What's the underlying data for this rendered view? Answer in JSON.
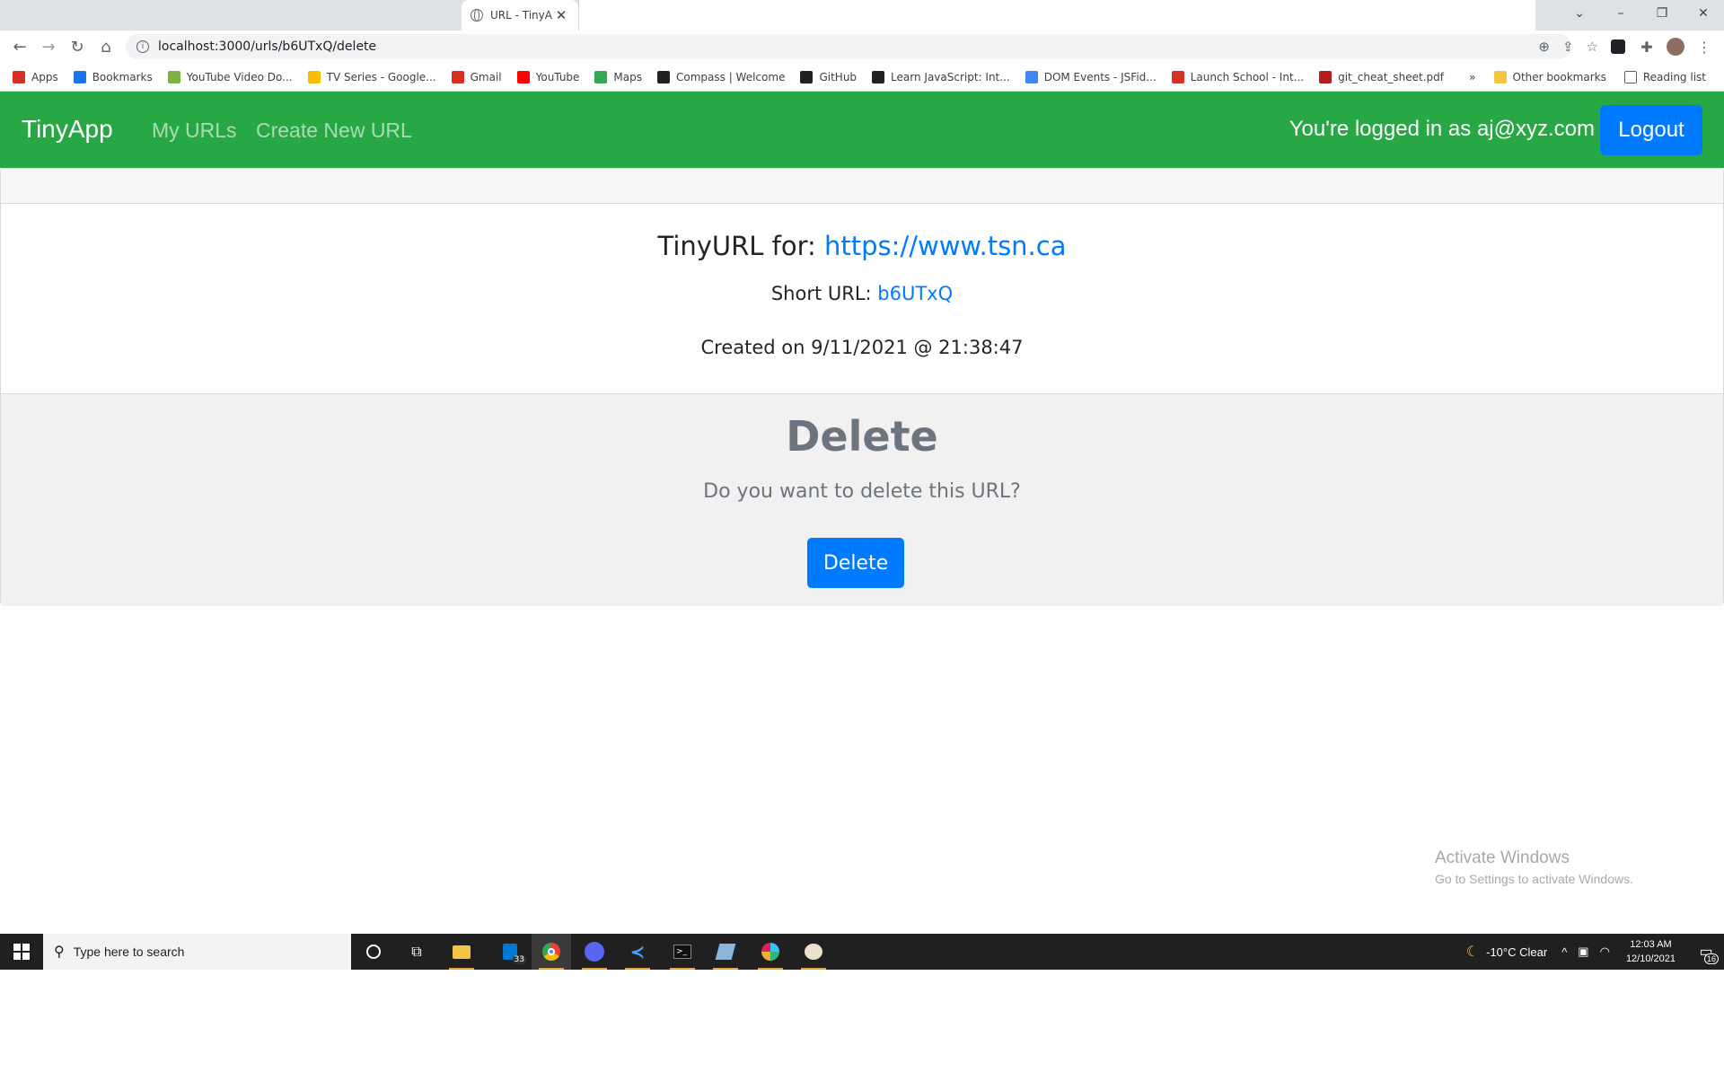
{
  "browser": {
    "tab_title": "URL - TinyA",
    "url": "localhost:3000/urls/b6UTxQ/delete",
    "bookmarks": [
      {
        "label": "Apps",
        "icon": "apps-grid-icon",
        "color": "#d93025"
      },
      {
        "label": "Bookmarks",
        "icon": "star-icon",
        "color": "#1a73e8"
      },
      {
        "label": "YouTube Video Do...",
        "icon": "download-icon",
        "color": "#7cb342"
      },
      {
        "label": "TV Series - Google...",
        "icon": "drive-icon",
        "color": "#fbbc04"
      },
      {
        "label": "Gmail",
        "icon": "gmail-icon",
        "color": "#d93025"
      },
      {
        "label": "YouTube",
        "icon": "youtube-icon",
        "color": "#ff0000"
      },
      {
        "label": "Maps",
        "icon": "maps-pin-icon",
        "color": "#34a853"
      },
      {
        "label": "Compass | Welcome",
        "icon": "compass-icon",
        "color": "#202124"
      },
      {
        "label": "GitHub",
        "icon": "github-icon",
        "color": "#202124"
      },
      {
        "label": "Learn JavaScript: Int...",
        "icon": "codecademy-icon",
        "color": "#202124"
      },
      {
        "label": "DOM Events - JSFid...",
        "icon": "jsfiddle-icon",
        "color": "#4285f4"
      },
      {
        "label": "Launch School - Int...",
        "icon": "launch-school-icon",
        "color": "#d93025"
      },
      {
        "label": "git_cheat_sheet.pdf",
        "icon": "pdf-icon",
        "color": "#b71c1c"
      }
    ],
    "more_label": "»",
    "other_bookmarks": "Other bookmarks",
    "reading_list": "Reading list"
  },
  "navbar": {
    "brand": "TinyApp",
    "my_urls": "My URLs",
    "create_new": "Create New URL",
    "logged_in_text": "You're logged in as aj@xyz.com",
    "logout_label": "Logout",
    "bg_color": "#28a745"
  },
  "card": {
    "title_prefix": "TinyURL for:",
    "long_url": "https://www.tsn.ca",
    "short_prefix": "Short URL:",
    "short_id": "b6UTxQ",
    "created": "Created on 9/11/2021 @ 21:38:47"
  },
  "delete": {
    "title": "Delete",
    "question": "Do you want to delete this URL?",
    "button_label": "Delete",
    "button_color": "#007bff"
  },
  "watermark": {
    "line1": "Activate Windows",
    "line2": "Go to Settings to activate Windows."
  },
  "taskbar": {
    "search_placeholder": "Type here to search",
    "store_badge": "33",
    "weather": "-10°C  Clear",
    "time": "12:03 AM",
    "date": "12/10/2021",
    "notifications": "16"
  }
}
